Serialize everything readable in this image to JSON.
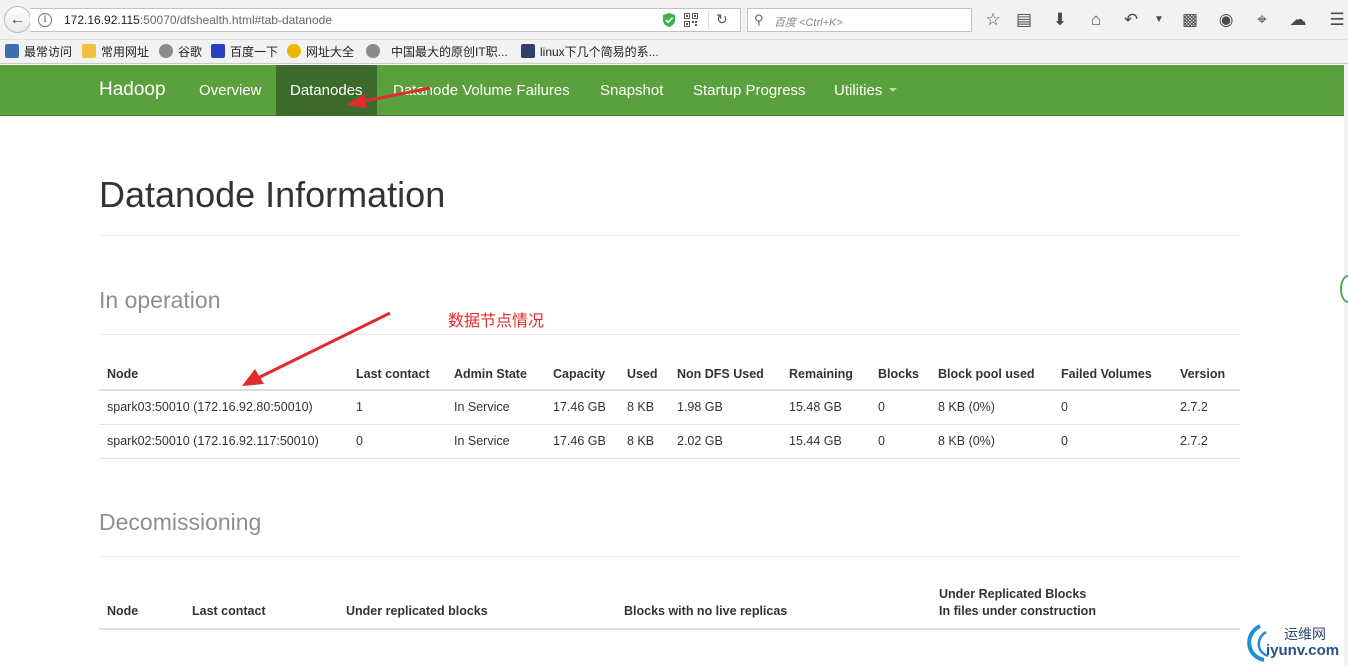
{
  "browser": {
    "url_host": "172.16.92.115",
    "url_rest": ":50070/dfshealth.html#tab-datanode",
    "search_placeholder": "百度 <Ctrl+K>",
    "bookmarks": [
      "最常访问",
      "常用网址",
      "谷歌",
      "百度一下",
      "网址大全",
      "中国最大的原创IT职...",
      "linux下几个简易的系..."
    ]
  },
  "navbar": {
    "brand": "Hadoop",
    "items": [
      "Overview",
      "Datanodes",
      "Datanode Volume Failures",
      "Snapshot",
      "Startup Progress",
      "Utilities"
    ],
    "active": "Datanodes"
  },
  "page": {
    "title": "Datanode Information",
    "annotation": "数据节点情况"
  },
  "in_operation": {
    "title": "In operation",
    "headers": [
      "Node",
      "Last contact",
      "Admin State",
      "Capacity",
      "Used",
      "Non DFS Used",
      "Remaining",
      "Blocks",
      "Block pool used",
      "Failed Volumes",
      "Version"
    ],
    "rows": [
      [
        "spark03:50010 (172.16.92.80:50010)",
        "1",
        "In Service",
        "17.46 GB",
        "8 KB",
        "1.98 GB",
        "15.48 GB",
        "0",
        "8 KB (0%)",
        "0",
        "2.7.2"
      ],
      [
        "spark02:50010 (172.16.92.117:50010)",
        "0",
        "In Service",
        "17.46 GB",
        "8 KB",
        "2.02 GB",
        "15.44 GB",
        "0",
        "8 KB (0%)",
        "0",
        "2.7.2"
      ]
    ]
  },
  "decomissioning": {
    "title": "Decomissioning",
    "headers": [
      "Node",
      "Last contact",
      "Under replicated blocks",
      "Blocks with no live replicas",
      "Under Replicated Blocks",
      "In files under construction"
    ]
  },
  "watermark": {
    "line1": "运维网",
    "line2": "iyunv.com"
  },
  "colors": {
    "navbar": "#5aa03d",
    "navbar_active": "#3d6b2c",
    "annotation": "#e22c2c"
  }
}
